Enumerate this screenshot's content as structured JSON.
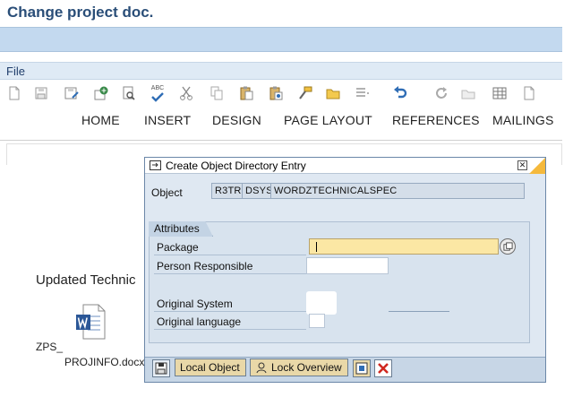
{
  "page": {
    "title": "Change project doc."
  },
  "menu": {
    "file": "File"
  },
  "ribbon": {
    "tabs": [
      "HOME",
      "INSERT",
      "DESIGN",
      "PAGE LAYOUT",
      "REFERENCES",
      "MAILINGS"
    ],
    "tools": [
      "new-doc-icon",
      "save-icon",
      "save-as-icon",
      "save-web-icon",
      "print-preview-icon",
      "spellcheck-icon",
      "cut-icon",
      "copy-icon",
      "paste-icon",
      "paste-special-icon",
      "format-painter-icon",
      "open-folder-icon",
      "bullets-icon",
      "undo-icon",
      "redo-icon",
      "open-icon",
      "table-icon",
      "blank-page-icon"
    ],
    "spellcheck_text": "ABC"
  },
  "document": {
    "heading": "Updated Technic",
    "attachment_line1": "ZPS_",
    "attachment_line2": "PROJINFO.docx"
  },
  "dialog": {
    "title": "Create Object Directory Entry",
    "object_label": "Object",
    "object_fields": [
      "R3TR",
      "DSYS",
      "WORDZTECHNICALSPEC"
    ],
    "attributes_tab": "Attributes",
    "rows": {
      "package": "Package",
      "person": "Person Responsible",
      "original_system": "Original System",
      "original_language": "Original language"
    },
    "package_value": "",
    "buttons": {
      "local_object": "Local Object",
      "lock_overview": "Lock Overview"
    }
  },
  "colors": {
    "title": "#2a4e78",
    "input_highlight": "#fbe7a4",
    "dialog_bg": "#dfe8f2",
    "cancel_red": "#d0281f"
  }
}
